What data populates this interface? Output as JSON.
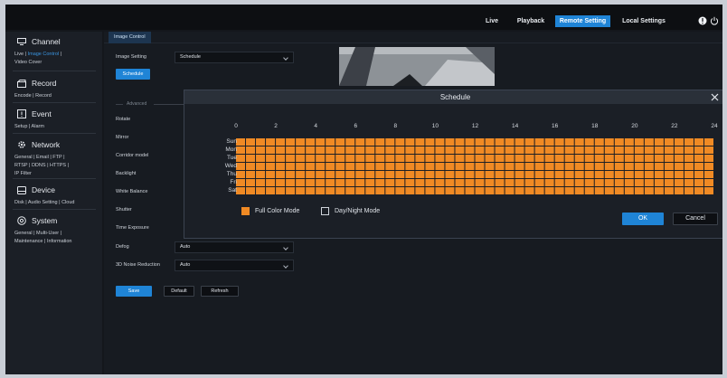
{
  "topnav": {
    "items": [
      {
        "label": "Live",
        "active": false
      },
      {
        "label": "Playback",
        "active": false
      },
      {
        "label": "Remote Setting",
        "active": true
      },
      {
        "label": "Local Settings",
        "active": false
      }
    ]
  },
  "sidebar": {
    "groups": [
      {
        "title": "Channel",
        "icon": "channel-icon",
        "links": [
          "Live | ",
          "Image Control",
          " |",
          "Video Cover"
        ]
      },
      {
        "title": "Record",
        "icon": "record-icon",
        "links": [
          "Encode | Record"
        ]
      },
      {
        "title": "Event",
        "icon": "event-icon",
        "links": [
          "Setup | Alarm"
        ]
      },
      {
        "title": "Network",
        "icon": "network-icon",
        "links": [
          "General | Email | FTP |",
          "RTSP | DDNS | HTTPS |",
          "IP Filter"
        ]
      },
      {
        "title": "Device",
        "icon": "device-icon",
        "links": [
          "Disk | Audio Setting | Cloud"
        ]
      },
      {
        "title": "System",
        "icon": "system-icon",
        "links": [
          "General | Multi-User |",
          "Maintenance | Information"
        ]
      }
    ]
  },
  "main": {
    "tab": "Image Control",
    "image_setting_label": "Image Setting",
    "image_setting_value": "Schedule",
    "schedule_button": "Schedule",
    "advanced_label": "Advanced",
    "rows": {
      "rotate": "Rotate",
      "mirror": "Mirror",
      "corridor": "Corridor model",
      "backlight": "Backlight",
      "white_balance": "White Balance",
      "shutter": "Shutter",
      "time_exposure": "Time Exposure",
      "defog": "Defog",
      "noise": "3D Noise Reduction"
    },
    "defog_value": "Auto",
    "noise_value": "Auto",
    "buttons": {
      "save": "Save",
      "default": "Default",
      "refresh": "Refresh"
    }
  },
  "modal": {
    "title": "Schedule",
    "hours": [
      "0",
      "2",
      "4",
      "6",
      "8",
      "10",
      "12",
      "14",
      "16",
      "18",
      "20",
      "22",
      "24"
    ],
    "days": [
      "Sun",
      "Mon",
      "Tue",
      "Wed",
      "Thu",
      "Fri",
      "Sat"
    ],
    "cells_per_day": 48,
    "legend_full": "Full Color Mode",
    "legend_daynight": "Day/Night Mode",
    "ok": "OK",
    "cancel": "Cancel"
  },
  "colors": {
    "accent": "#1f84d6",
    "full_color": "#f08a24",
    "grid_line": "#1b1f26"
  }
}
